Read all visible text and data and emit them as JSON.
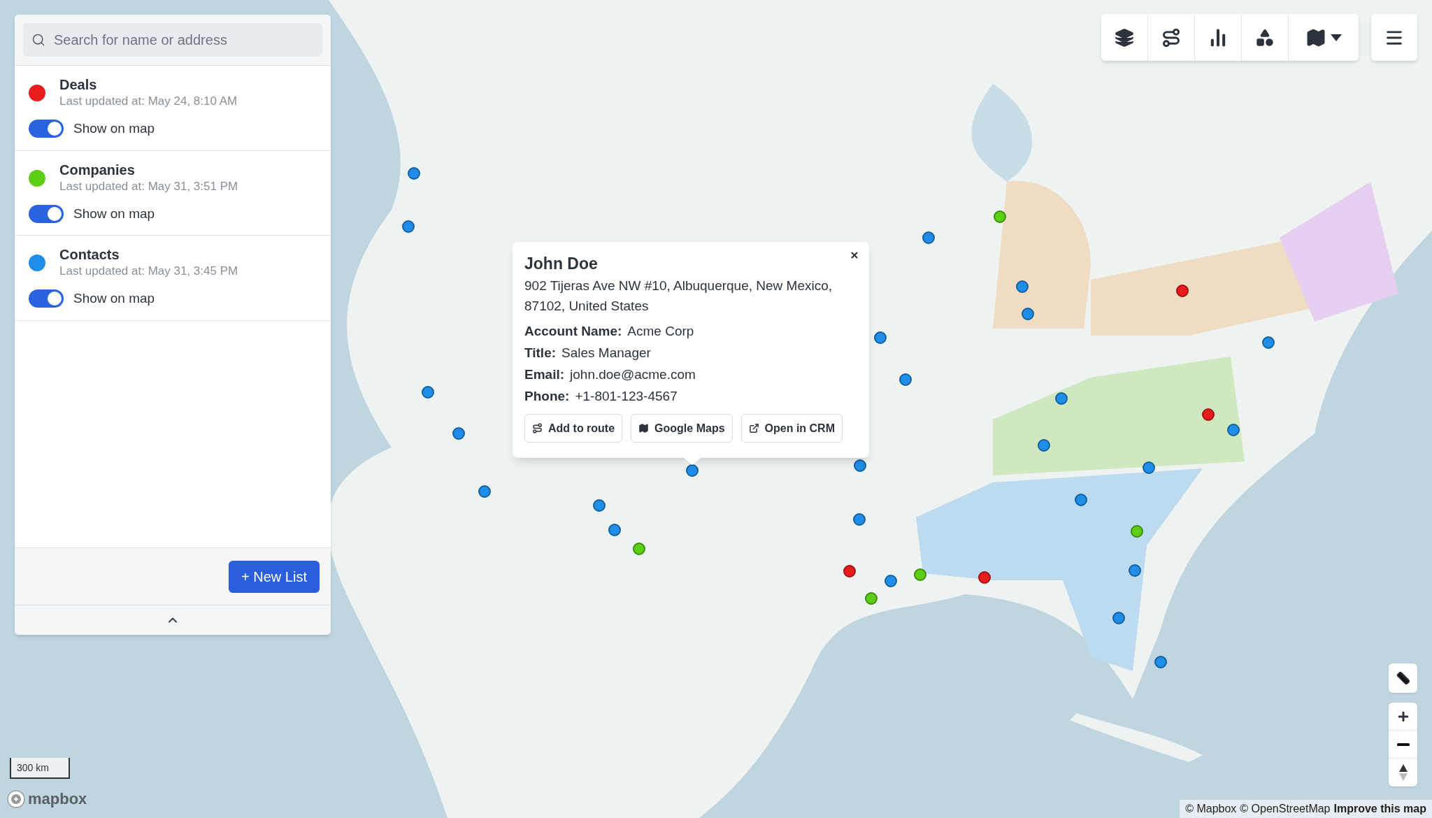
{
  "search": {
    "placeholder": "Search for name or address"
  },
  "lists": [
    {
      "name": "Deals",
      "updated": "Last updated at: May 24, 8:10 AM",
      "color": "#e81c1c",
      "toggle_label": "Show on map",
      "show_on_map": true
    },
    {
      "name": "Companies",
      "updated": "Last updated at: May 31, 3:51 PM",
      "color": "#5ccf14",
      "toggle_label": "Show on map",
      "show_on_map": true
    },
    {
      "name": "Contacts",
      "updated": "Last updated at: May 31, 3:45 PM",
      "color": "#1e8ee8",
      "toggle_label": "Show on map",
      "show_on_map": true
    }
  ],
  "new_list_button": "+ New List",
  "popup": {
    "name": "John Doe",
    "address": "902 Tijeras Ave NW #10, Albuquerque, New Mexico, 87102, United States",
    "fields": [
      {
        "label": "Account Name:",
        "value": "Acme Corp"
      },
      {
        "label": "Title:",
        "value": "Sales Manager"
      },
      {
        "label": "Email:",
        "value": "john.doe@acme.com"
      },
      {
        "label": "Phone:",
        "value": "+1-801-123-4567"
      }
    ],
    "actions": [
      {
        "kind": "route",
        "label": "Add to route"
      },
      {
        "kind": "maps",
        "label": "Google Maps"
      },
      {
        "kind": "crm",
        "label": "Open in CRM"
      }
    ]
  },
  "scale": "300 km",
  "logo": "mapbox",
  "attribution": {
    "mapbox": "© Mapbox",
    "osm": "© OpenStreetMap",
    "improve": "Improve this map"
  }
}
